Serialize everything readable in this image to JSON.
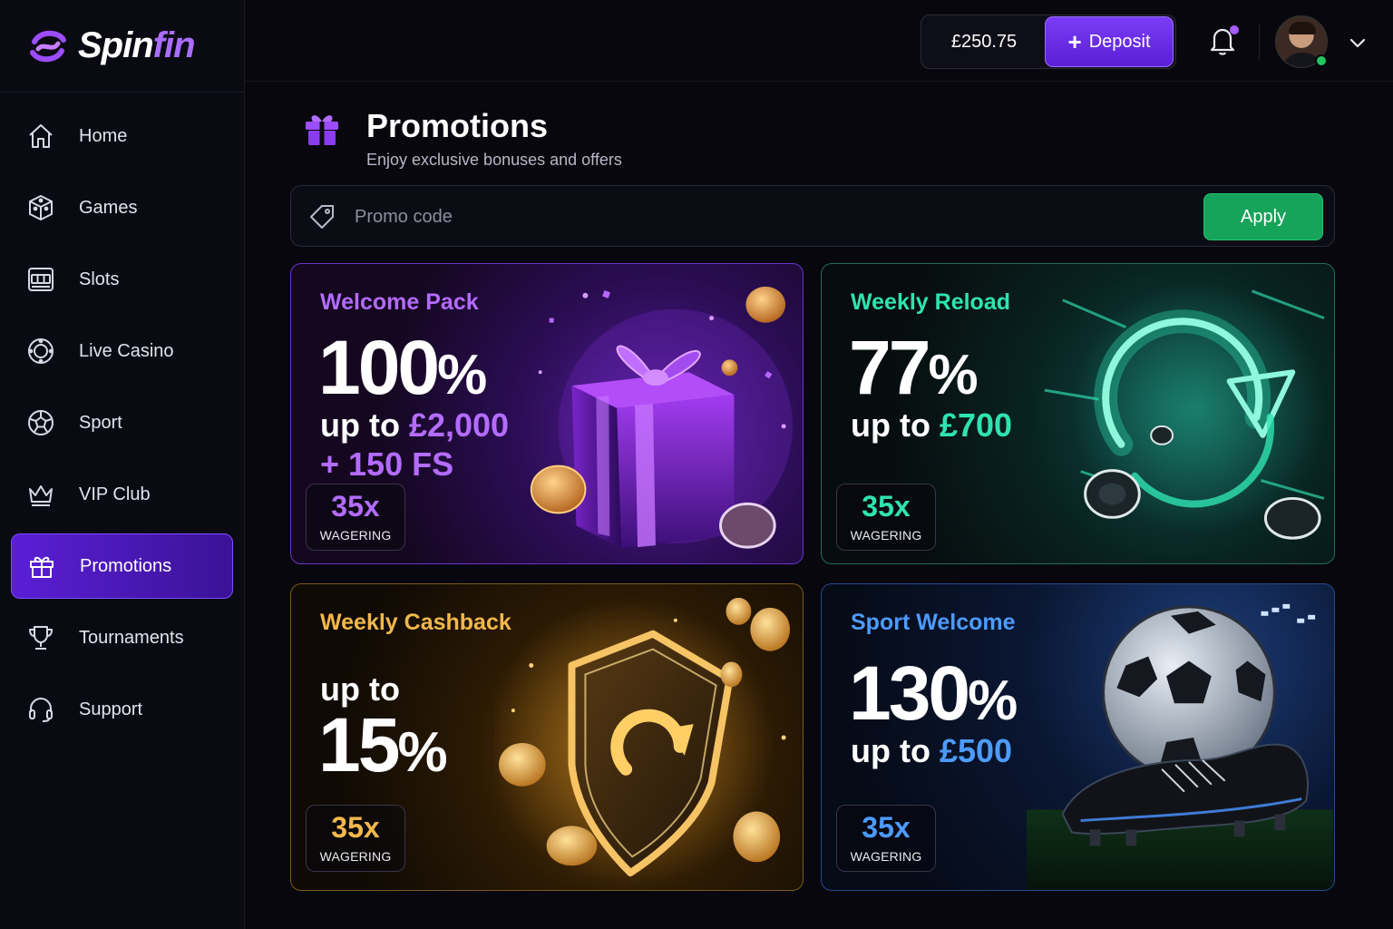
{
  "brand": {
    "name_part1": "Spin",
    "name_part2": "fin"
  },
  "nav": [
    {
      "label": "Home",
      "icon": "home-icon"
    },
    {
      "label": "Games",
      "icon": "cube-icon"
    },
    {
      "label": "Slots",
      "icon": "slot-machine-icon"
    },
    {
      "label": "Live Casino",
      "icon": "live-casino-icon"
    },
    {
      "label": "Sport",
      "icon": "soccer-ball-icon"
    },
    {
      "label": "VIP Club",
      "icon": "crown-icon"
    },
    {
      "label": "Promotions",
      "icon": "gift-icon",
      "active": true
    },
    {
      "label": "Tournaments",
      "icon": "trophy-icon"
    },
    {
      "label": "Support",
      "icon": "headset-icon"
    }
  ],
  "header": {
    "balance": "£250.75",
    "deposit_label": "Deposit"
  },
  "page": {
    "title": "Promotions",
    "subtitle": "Enjoy exclusive bonuses and offers"
  },
  "promo": {
    "placeholder": "Promo code",
    "apply_label": "Apply"
  },
  "cards": [
    {
      "title": "Welcome Pack",
      "big": "100",
      "pct": "%",
      "line1_prefix": "up to ",
      "line1_value": "£2,000",
      "line2": "+ 150 FS",
      "wager_value": "35x",
      "wager_label": "WAGERING",
      "accent": "#b46bff"
    },
    {
      "title": "Weekly Reload",
      "big": "77",
      "pct": "%",
      "line1_prefix": "up to ",
      "line1_value": "£700",
      "wager_value": "35x",
      "wager_label": "WAGERING",
      "accent": "#2fe3b1"
    },
    {
      "title": "Weekly Cashback",
      "line0": "up to",
      "big": "15",
      "pct": "%",
      "wager_value": "35x",
      "wager_label": "WAGERING",
      "accent": "#f2b84b"
    },
    {
      "title": "Sport Welcome",
      "big": "130",
      "pct": "%",
      "line1_prefix": "up to ",
      "line1_value": "£500",
      "wager_value": "35x",
      "wager_label": "WAGERING",
      "accent": "#4d9bff"
    }
  ]
}
